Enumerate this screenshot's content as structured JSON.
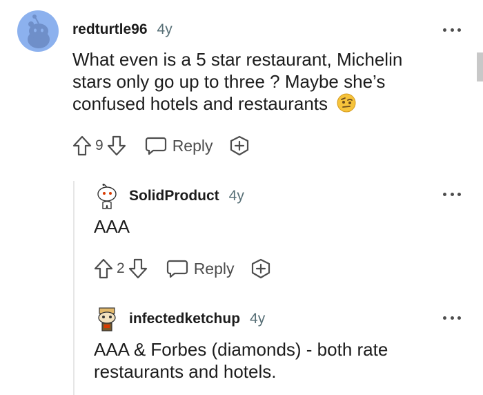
{
  "comments": [
    {
      "username": "redturtle96",
      "age": "4y",
      "text": "What even is a 5 star restaurant, Michelin stars only go up to three ? Maybe she’s confused hotels and restaurants",
      "emoji": "face-with-raised-eyebrow",
      "votes": "9",
      "reply_label": "Reply"
    },
    {
      "username": "SolidProduct",
      "age": "4y",
      "text": "AAA",
      "votes": "2",
      "reply_label": "Reply"
    },
    {
      "username": "infectedketchup",
      "age": "4y",
      "text": "AAA & Forbes (diamonds) - both rate restaurants and hotels."
    }
  ],
  "colors": {
    "text": "#1c1c1c",
    "meta": "#576f76",
    "icon": "#4d4d4d",
    "avatar_bg": "#8cb1ee",
    "thread_line": "#e6e6e6"
  }
}
